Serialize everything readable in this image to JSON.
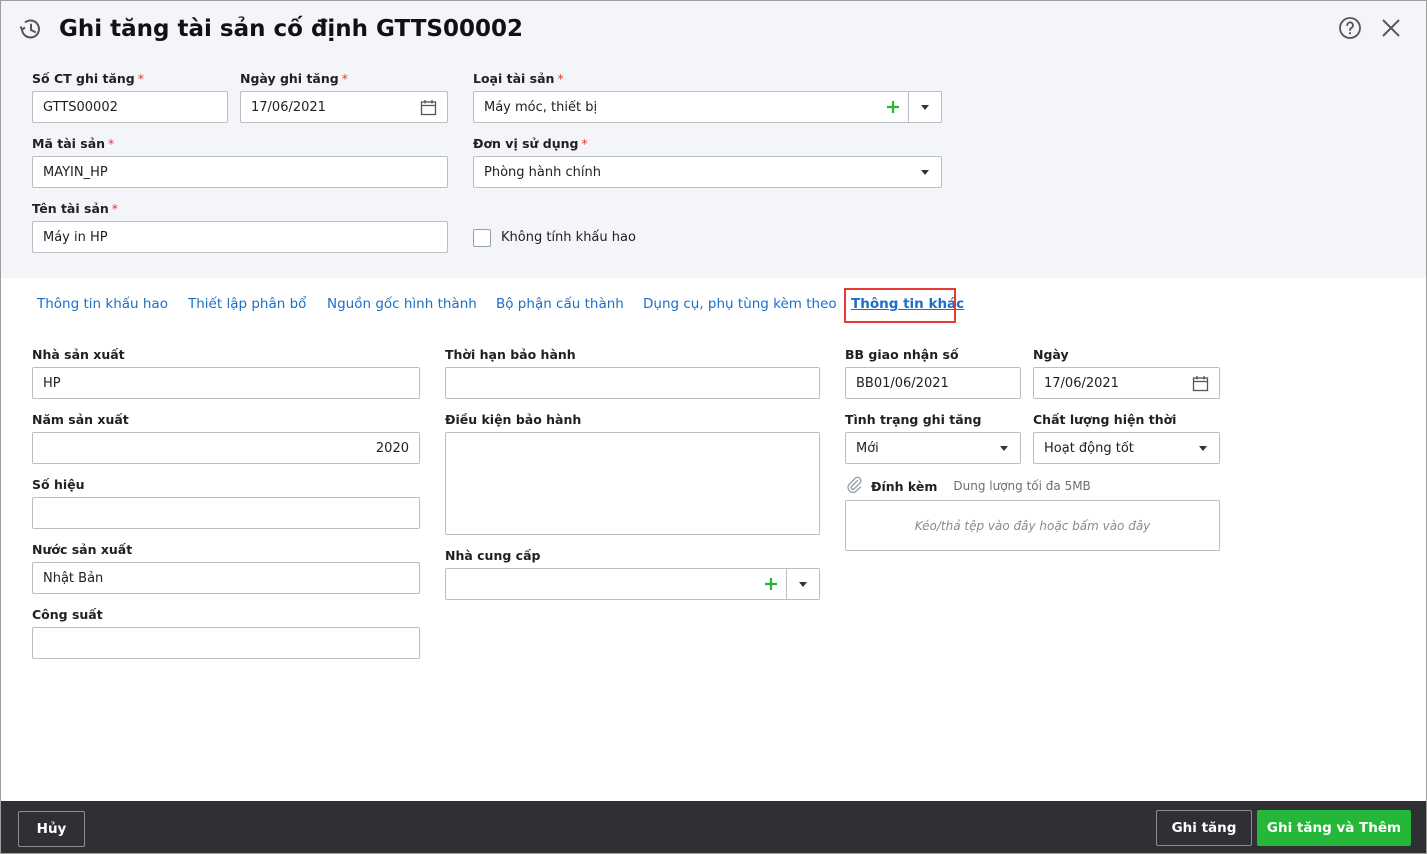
{
  "header": {
    "title": "Ghi tăng tài sản cố định GTTS00002",
    "fields": {
      "so_ct": {
        "label": "Số CT ghi tăng",
        "value": "GTTS00002"
      },
      "ngay_ghi_tang": {
        "label": "Ngày ghi tăng",
        "value": "17/06/2021"
      },
      "loai_tai_san": {
        "label": "Loại tài sản",
        "value": "Máy móc, thiết bị"
      },
      "ma_tai_san": {
        "label": "Mã tài sản",
        "value": "MAYIN_HP"
      },
      "don_vi_su_dung": {
        "label": "Đơn vị sử dụng",
        "value": "Phòng hành chính"
      },
      "ten_tai_san": {
        "label": "Tên tài sản",
        "value": "Máy in HP"
      },
      "khong_tinh_khau_hao": {
        "label": "Không tính khấu hao",
        "checked": false
      }
    },
    "required_mark": "*"
  },
  "tabs": [
    {
      "label": "Thông tin khấu hao",
      "active": false
    },
    {
      "label": "Thiết lập phân bổ",
      "active": false
    },
    {
      "label": "Nguồn gốc hình thành",
      "active": false
    },
    {
      "label": "Bộ phận cấu thành",
      "active": false
    },
    {
      "label": "Dụng cụ, phụ tùng kèm theo",
      "active": false
    },
    {
      "label": "Thông tin khác",
      "active": true
    }
  ],
  "other_info": {
    "nha_san_xuat": {
      "label": "Nhà sản xuất",
      "value": "HP"
    },
    "nam_san_xuat": {
      "label": "Năm sản xuất",
      "value": "2020"
    },
    "so_hieu": {
      "label": "Số hiệu",
      "value": ""
    },
    "nuoc_san_xuat": {
      "label": "Nước sản xuất",
      "value": "Nhật Bản"
    },
    "cong_suat": {
      "label": "Công suất",
      "value": ""
    },
    "thoi_han_bao_hanh": {
      "label": "Thời hạn bảo hành",
      "value": ""
    },
    "dieu_kien_bao_hanh": {
      "label": "Điều kiện bảo hành",
      "value": ""
    },
    "nha_cung_cap": {
      "label": "Nhà cung cấp",
      "value": ""
    },
    "bb_giao_nhan_so": {
      "label": "BB giao nhận số",
      "value": "BB01/06/2021"
    },
    "ngay": {
      "label": "Ngày",
      "value": "17/06/2021"
    },
    "tinh_trang_ghi_tang": {
      "label": "Tình trạng ghi tăng",
      "value": "Mới"
    },
    "chat_luong_hien_thoi": {
      "label": "Chất lượng hiện thời",
      "value": "Hoạt động tốt"
    },
    "dinh_kem": {
      "label": "Đính kèm",
      "hint": "Dung lượng tối đa 5MB",
      "dropzone": "Kéo/thả tệp vào đây hoặc bấm vào đây"
    }
  },
  "footer": {
    "cancel_label": "Hủy",
    "save_label": "Ghi tăng",
    "save_add_label": "Ghi tăng và Thêm"
  },
  "colors": {
    "accent_green": "#25b838",
    "link_blue": "#1c6fc9",
    "highlight_red": "#e53935",
    "footer_bg": "#2f3033"
  },
  "icons": {
    "title": "history-icon",
    "help": "help-circle-icon",
    "close": "close-icon",
    "calendar": "calendar-icon",
    "add": "plus-icon",
    "dropdown": "caret-down-icon",
    "attach": "paperclip-icon"
  }
}
